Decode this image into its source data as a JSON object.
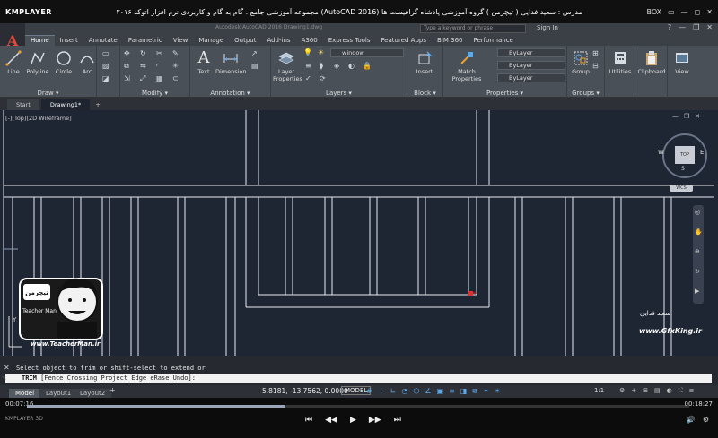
{
  "player": {
    "logo": "KMPLAYER",
    "title": "مجموعه آموزشی جامع ، گام به گام و کاربردی نرم افزار اتوکد ۲۰۱۶ (AutoCAD 2016) مدرس : سعید فدایی ( تیچرمن ) گروه آموزشی پادشاه گرافیست ها",
    "window_controls": [
      "BOX",
      "▭",
      "—",
      "◻",
      "✕"
    ],
    "time_current": "00:07:16",
    "time_total": "00:18:27",
    "progress": 0.39,
    "controls": [
      "⏮",
      "◀◀",
      "▶",
      "▶▶",
      "⏭"
    ],
    "left_status": "KMPLAYER 3D"
  },
  "acad": {
    "logo": "A",
    "doc_title": "Autodesk AutoCAD 2016    Drawing1.dwg",
    "search_placeholder": "Type a keyword or phrase",
    "signin": "Sign In",
    "ribbon_tabs": [
      "Home",
      "Insert",
      "Annotate",
      "Parametric",
      "View",
      "Manage",
      "Output",
      "Add-ins",
      "A360",
      "Express Tools",
      "Featured Apps",
      "BIM 360",
      "Performance"
    ],
    "active_tab": "Home",
    "panels": {
      "draw": {
        "title": "Draw ▾",
        "line": "Line",
        "polyline": "Polyline",
        "circle": "Circle",
        "arc": "Arc"
      },
      "modify": {
        "title": "Modify ▾"
      },
      "annotation": {
        "title": "Annotation ▾",
        "text": "Text",
        "dimension": "Dimension"
      },
      "layers": {
        "title": "Layers ▾",
        "layer_properties": "Layer Properties",
        "current_layer": "window"
      },
      "block": {
        "title": "Block ▾",
        "insert": "Insert"
      },
      "properties": {
        "title": "Properties ▾",
        "match": "Match Properties",
        "color": "ByLayer",
        "linetype": "ByLayer",
        "lineweight": "ByLayer"
      },
      "groups": {
        "title": "Groups ▾",
        "group": "Group"
      },
      "utilities": {
        "label": "Utilities"
      },
      "clipboard": {
        "label": "Clipboard"
      },
      "view": {
        "label": "View"
      }
    },
    "doc_tabs": [
      "Start",
      "Drawing1*"
    ],
    "viewport_label": "[-][Top][2D Wireframe]",
    "viewcube": {
      "top": "TOP",
      "west": "W",
      "east": "E",
      "south": "S",
      "wcs": "WCS"
    },
    "command_history": "Select object to trim or shift-select to extend or",
    "command_prompt": "TRIM",
    "command_options": [
      "Fence",
      "Crossing",
      "Project",
      "Edge",
      "eRase",
      "Undo"
    ],
    "layout_tabs": [
      "Model",
      "Layout1",
      "Layout2"
    ],
    "coords": "5.8181, -13.7562, 0.0000",
    "model_button": "MODEL",
    "annotation_scale": "1:1"
  },
  "watermark": {
    "badge_text": "تیچرمن",
    "badge_sub": "Teacher Man",
    "url": "www.TeacherMan.ir",
    "signature": "سعید فدایی",
    "site": "www.GfxKing.ir"
  }
}
